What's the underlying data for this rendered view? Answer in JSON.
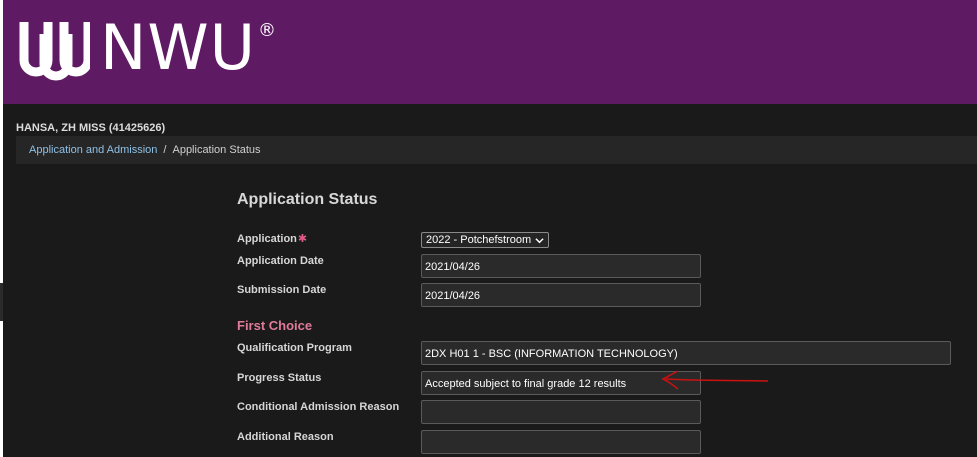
{
  "brand": {
    "name": "NWU",
    "registered": "®"
  },
  "colors": {
    "header_bg": "#5e1a63",
    "link": "#8ec0e6",
    "section_title": "#e07a9a",
    "required": "#e05a8a",
    "annotation": "#cc1111"
  },
  "user": {
    "name": "HANSA, ZH MISS (41425626)"
  },
  "breadcrumb": {
    "parent": "Application and Admission",
    "separator": "/",
    "current": "Application Status"
  },
  "page": {
    "title": "Application Status"
  },
  "form": {
    "application": {
      "label": "Application",
      "required_mark": "✱",
      "selected": "2022 - Potchefstroom"
    },
    "application_date": {
      "label": "Application Date",
      "value": "2021/04/26"
    },
    "submission_date": {
      "label": "Submission Date",
      "value": "2021/04/26"
    },
    "first_choice_title": "First Choice",
    "qualification_program": {
      "label": "Qualification Program",
      "value": "2DX H01 1 - BSC (INFORMATION TECHNOLOGY)"
    },
    "progress_status": {
      "label": "Progress Status",
      "value": "Accepted subject to final grade 12 results"
    },
    "conditional_admission_reason": {
      "label": "Conditional Admission Reason",
      "value": ""
    },
    "additional_reason": {
      "label": "Additional Reason",
      "value": ""
    }
  },
  "icons": {
    "select_chevron": "chevron-down-icon",
    "annotation": "red-arrow-annotation"
  }
}
